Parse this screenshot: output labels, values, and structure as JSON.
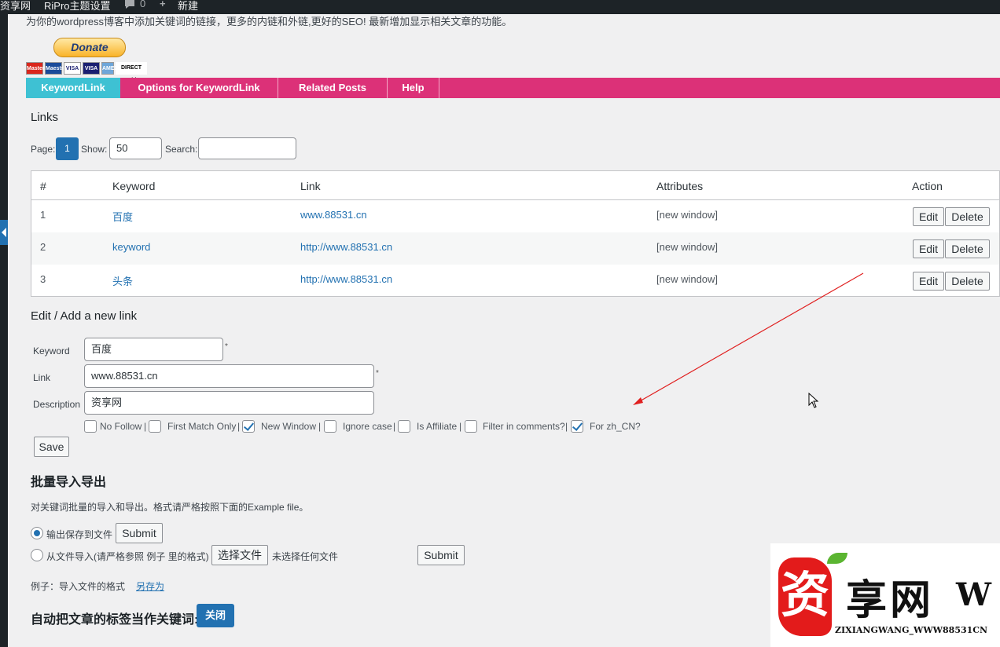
{
  "adminbar": {
    "site_name": "资享网",
    "theme_settings": "RiPro主题设置",
    "comments_count": "0",
    "new_label": "新建"
  },
  "intro": "为你的wordpress博客中添加关键词的链接，更多的内链和外链,更好的SEO! 最新增加显示相关文章的功能。",
  "donate": {
    "label": "Donate",
    "cards": [
      "MasterCard",
      "Maestro",
      "VISA",
      "VISA",
      "AMEX",
      "DIRECT Debit"
    ]
  },
  "tabs": [
    {
      "label": "KeywordLink",
      "active": true
    },
    {
      "label": "Options for KeywordLink",
      "active": false
    },
    {
      "label": "Related Posts",
      "active": false
    },
    {
      "label": "Help",
      "active": false
    }
  ],
  "links_section": {
    "title": "Links",
    "page_label": "Page:",
    "page_value": "1",
    "show_label": "Show:",
    "show_value": "50",
    "search_label": "Search:",
    "search_value": ""
  },
  "table": {
    "headers": [
      "#",
      "Keyword",
      "Link",
      "Attributes",
      "Action"
    ],
    "rows": [
      {
        "num": "1",
        "keyword": "百度",
        "link": "www.88531.cn",
        "attributes": "[new window]"
      },
      {
        "num": "2",
        "keyword": "keyword",
        "link": "http://www.88531.cn",
        "attributes": "[new window]"
      },
      {
        "num": "3",
        "keyword": "头条",
        "link": "http://www.88531.cn",
        "attributes": "[new window]"
      }
    ],
    "edit_label": "Edit",
    "delete_label": "Delete"
  },
  "edit_form": {
    "title": "Edit / Add a new link",
    "keyword_label": "Keyword",
    "keyword_value": "百度",
    "link_label": "Link",
    "link_value": "www.88531.cn",
    "description_label": "Description",
    "description_value": "资享网",
    "required_mark": "*",
    "options": [
      {
        "label": "No Follow",
        "checked": false
      },
      {
        "label": "First Match Only",
        "checked": false
      },
      {
        "label": "New Window",
        "checked": true
      },
      {
        "label": "Ignore case",
        "checked": false
      },
      {
        "label": "Is Affiliate",
        "checked": false
      },
      {
        "label": "Filter in comments?",
        "checked": false
      },
      {
        "label": "For zh_CN?",
        "checked": true
      }
    ],
    "separator": "|",
    "save_label": "Save"
  },
  "bulk": {
    "title": "批量导入导出",
    "description": "对关键词批量的导入和导出。格式请严格按照下面的Example file。",
    "export_label": "输出保存到文件",
    "export_checked": true,
    "submit_label": "Submit",
    "import_label": "从文件导入(请严格参照 例子 里的格式)",
    "import_checked": false,
    "choose_file_label": "选择文件",
    "no_file_label": "未选择任何文件",
    "example_prefix": "例子：导入文件的格式",
    "example_link": "另存为"
  },
  "auto_tags": {
    "label": "自动把文章的标签当作关键词:",
    "toggle_label": "关闭"
  },
  "watermark": {
    "mark": "资",
    "text": "享网",
    "suffix": "W",
    "subtitle": "ZIXIANGWANG_WWW88531CN"
  },
  "colors": {
    "tab_bar": "#dc3178",
    "tab_active": "#3ec1d3",
    "primary": "#2271b1",
    "annotation_arrow": "#e02020",
    "watermark_red": "#e31b1b"
  }
}
